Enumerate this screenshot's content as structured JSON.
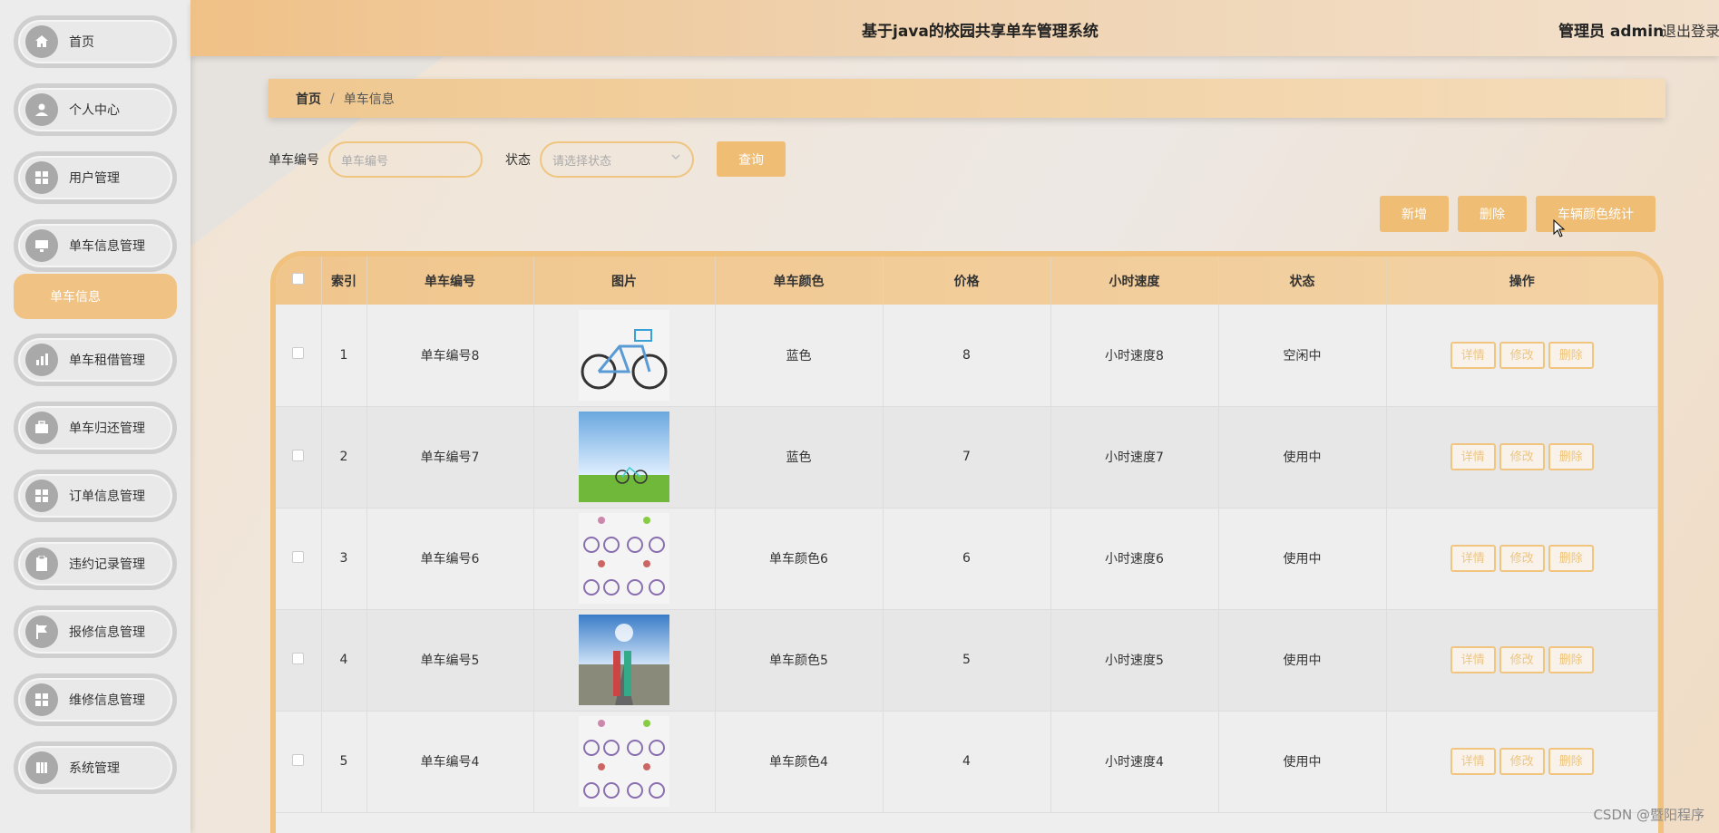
{
  "header": {
    "title": "基于java的校园共享单车管理系统",
    "user": "管理员 admin",
    "logout": "退出登录"
  },
  "sidebar": {
    "items": [
      {
        "label": "首页",
        "icon": "home-icon"
      },
      {
        "label": "个人中心",
        "icon": "user-icon"
      },
      {
        "label": "用户管理",
        "icon": "grid-icon"
      },
      {
        "label": "单车信息管理",
        "icon": "monitor-icon"
      },
      {
        "label": "单车租借管理",
        "icon": "chart-icon"
      },
      {
        "label": "单车归还管理",
        "icon": "briefcase-icon"
      },
      {
        "label": "订单信息管理",
        "icon": "grid-icon"
      },
      {
        "label": "违约记录管理",
        "icon": "clipboard-icon"
      },
      {
        "label": "报修信息管理",
        "icon": "flag-icon"
      },
      {
        "label": "维修信息管理",
        "icon": "grid-icon"
      },
      {
        "label": "系统管理",
        "icon": "book-icon"
      }
    ],
    "submenu": "单车信息"
  },
  "breadcrumb": {
    "home": "首页",
    "sep": "/",
    "current": "单车信息"
  },
  "search": {
    "bike_no_label": "单车编号",
    "bike_no_placeholder": "单车编号",
    "status_label": "状态",
    "status_placeholder": "请选择状态",
    "query_button": "查询"
  },
  "actions": {
    "add": "新增",
    "delete": "删除",
    "color_stats": "车辆颜色统计"
  },
  "table": {
    "headers": [
      "索引",
      "单车编号",
      "图片",
      "单车颜色",
      "价格",
      "小时速度",
      "状态",
      "操作"
    ],
    "rows": [
      {
        "index": "1",
        "bike_no": "单车编号8",
        "color": "蓝色",
        "price": "8",
        "speed": "小时速度8",
        "status": "空闲中"
      },
      {
        "index": "2",
        "bike_no": "单车编号7",
        "color": "蓝色",
        "price": "7",
        "speed": "小时速度7",
        "status": "使用中"
      },
      {
        "index": "3",
        "bike_no": "单车编号6",
        "color": "单车颜色6",
        "price": "6",
        "speed": "小时速度6",
        "status": "使用中"
      },
      {
        "index": "4",
        "bike_no": "单车编号5",
        "color": "单车颜色5",
        "price": "5",
        "speed": "小时速度5",
        "status": "使用中"
      },
      {
        "index": "5",
        "bike_no": "单车编号4",
        "color": "单车颜色4",
        "price": "4",
        "speed": "小时速度4",
        "status": "使用中"
      }
    ],
    "op_labels": {
      "detail": "详情",
      "edit": "修改",
      "delete": "删除"
    }
  },
  "watermark": "CSDN @暨阳程序",
  "colors": {
    "accent": "#efbd74",
    "accent_border": "#efc57f"
  }
}
